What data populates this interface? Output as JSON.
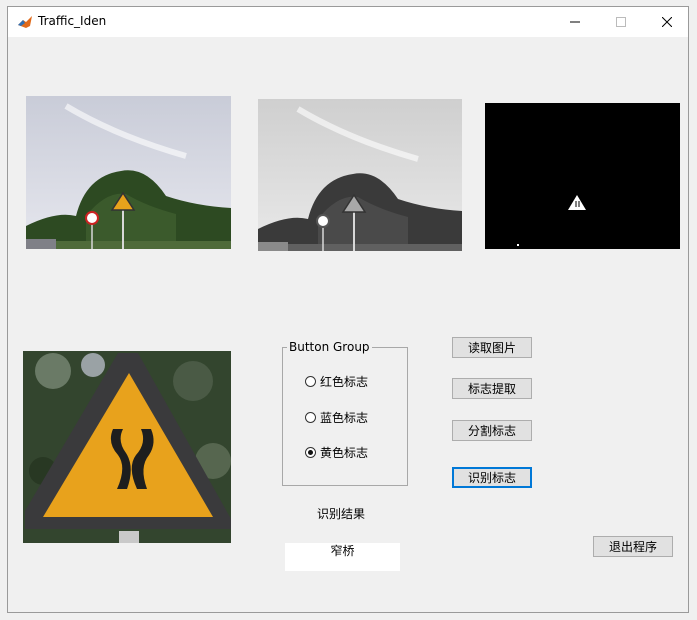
{
  "window": {
    "title": "Traffic_Iden"
  },
  "controls": {
    "minimize": "—",
    "maximize": "☐",
    "close": "✕"
  },
  "group": {
    "title": "Button Group",
    "options": [
      {
        "label": "红色标志",
        "selected": false
      },
      {
        "label": "蓝色标志",
        "selected": false
      },
      {
        "label": "黄色标志",
        "selected": true
      }
    ]
  },
  "buttons": {
    "read": "读取图片",
    "extract": "标志提取",
    "segment": "分割标志",
    "recognize": "识别标志",
    "exit": "退出程序"
  },
  "result": {
    "label": "识别结果",
    "value": "窄桥"
  }
}
